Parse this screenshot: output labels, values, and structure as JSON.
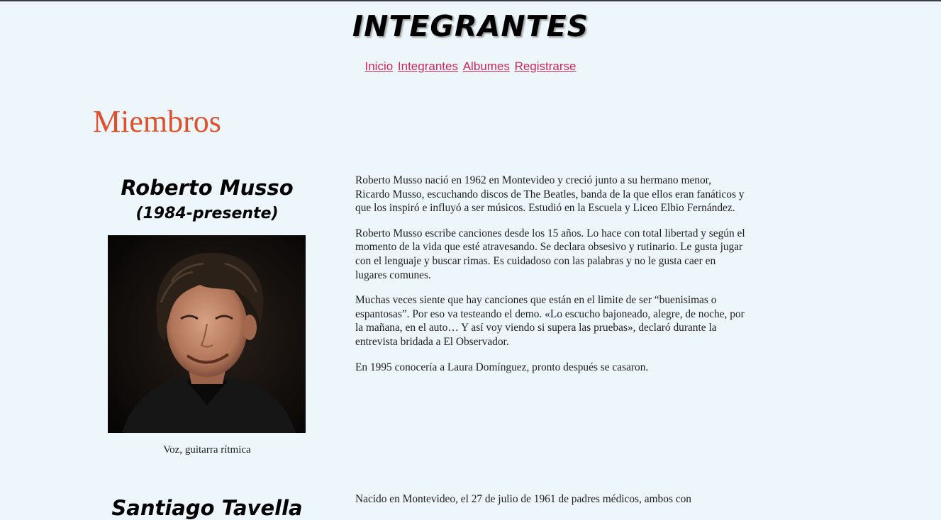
{
  "header": {
    "title": "INTEGRANTES"
  },
  "nav": {
    "items": [
      {
        "label": "Inicio"
      },
      {
        "label": "Integrantes"
      },
      {
        "label": "Albumes"
      },
      {
        "label": "Registrarse"
      }
    ]
  },
  "main": {
    "section_title": "Miembros",
    "members": [
      {
        "name": "Roberto Musso",
        "years": "(1984-presente)",
        "caption": "Voz, guitarra rítmica",
        "paragraphs": [
          "Roberto Musso nació en 1962 en Montevideo y creció junto a su hermano menor, Ricardo Musso, escuchando discos de The Beatles, banda de la que ellos eran fanáticos y que los inspiró e influyó a ser músicos. Estudió en la Escuela y Liceo Elbio Fernández.",
          "Roberto Musso escribe canciones desde los 15 años. Lo hace con total libertad y según el momento de la vida que esté atravesando. Se declara obsesivo y rutinario. Le gusta jugar con el lenguaje y buscar rimas. Es cuidadoso con las palabras y no le gusta caer en lugares comunes.",
          "Muchas veces siente que hay canciones que están en el limite de ser “buenisimas o espantosas”. Por eso va testeando el demo. «Lo escucho bajoneado, alegre, de noche, por la mañana, en el auto… Y así voy viendo si supera las pruebas», declaró durante la entrevista bridada a El Observador.",
          "En 1995 conocería a Laura Domínguez, pronto después se casaron."
        ]
      },
      {
        "name": "Santiago Tavella",
        "paragraphs": [
          "Nacido en Montevideo, el 27 de julio de 1961 de padres médicos, ambos con"
        ]
      }
    ]
  },
  "colors": {
    "background": "#edf6fb",
    "link": "#d2245b",
    "section_title": "#e0502c"
  }
}
